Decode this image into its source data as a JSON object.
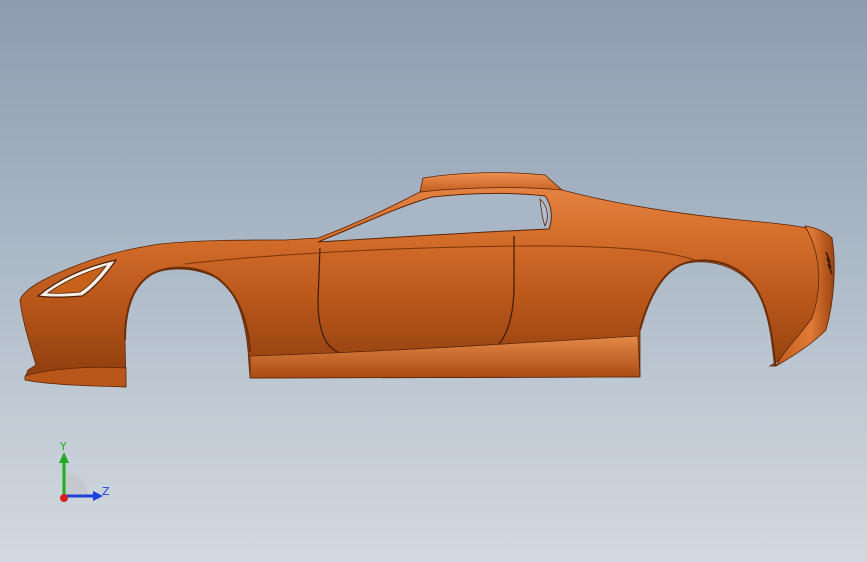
{
  "model": {
    "part": "car-body-shell",
    "color": "#c8611a"
  },
  "triad": {
    "y_label": "Y",
    "z_label": "Z",
    "y_color": "#1fae1f",
    "z_color": "#1f3fd8",
    "x_color": "#d81f1f"
  }
}
